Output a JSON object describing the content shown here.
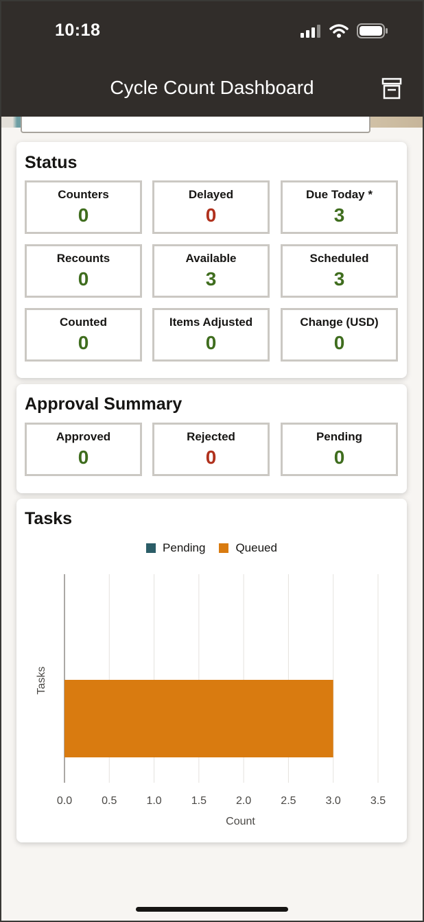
{
  "status_bar": {
    "time": "10:18"
  },
  "header": {
    "title": "Cycle Count Dashboard"
  },
  "status_card": {
    "title": "Status",
    "tiles": [
      {
        "label": "Counters",
        "value": "0",
        "color": "green"
      },
      {
        "label": "Delayed",
        "value": "0",
        "color": "red"
      },
      {
        "label": "Due Today *",
        "value": "3",
        "color": "green"
      },
      {
        "label": "Recounts",
        "value": "0",
        "color": "green"
      },
      {
        "label": "Available",
        "value": "3",
        "color": "green"
      },
      {
        "label": "Scheduled",
        "value": "3",
        "color": "green"
      },
      {
        "label": "Counted",
        "value": "0",
        "color": "green"
      },
      {
        "label": "Items Adjusted",
        "value": "0",
        "color": "green"
      },
      {
        "label": "Change (USD)",
        "value": "0",
        "color": "green"
      }
    ]
  },
  "approval_card": {
    "title": "Approval Summary",
    "tiles": [
      {
        "label": "Approved",
        "value": "0",
        "color": "green"
      },
      {
        "label": "Rejected",
        "value": "0",
        "color": "red"
      },
      {
        "label": "Pending",
        "value": "0",
        "color": "green"
      }
    ]
  },
  "tasks_card": {
    "title": "Tasks"
  },
  "colors": {
    "header_bg": "#312d2a",
    "value_green": "#3f6d1e",
    "value_red": "#b0311d",
    "pending": "#2b5d67",
    "queued": "#d97b10"
  },
  "chart_data": {
    "type": "bar",
    "orientation": "horizontal",
    "series": [
      {
        "name": "Pending",
        "values": [
          0
        ],
        "color": "#2b5d67"
      },
      {
        "name": "Queued",
        "values": [
          3
        ],
        "color": "#d97b10"
      }
    ],
    "xlabel": "Count",
    "ylabel": "Tasks",
    "xlim": [
      0,
      3.5
    ],
    "xticks": [
      "0.0",
      "0.5",
      "1.0",
      "1.5",
      "2.0",
      "2.5",
      "3.0",
      "3.5"
    ],
    "grid": true,
    "legend": "top-center"
  }
}
